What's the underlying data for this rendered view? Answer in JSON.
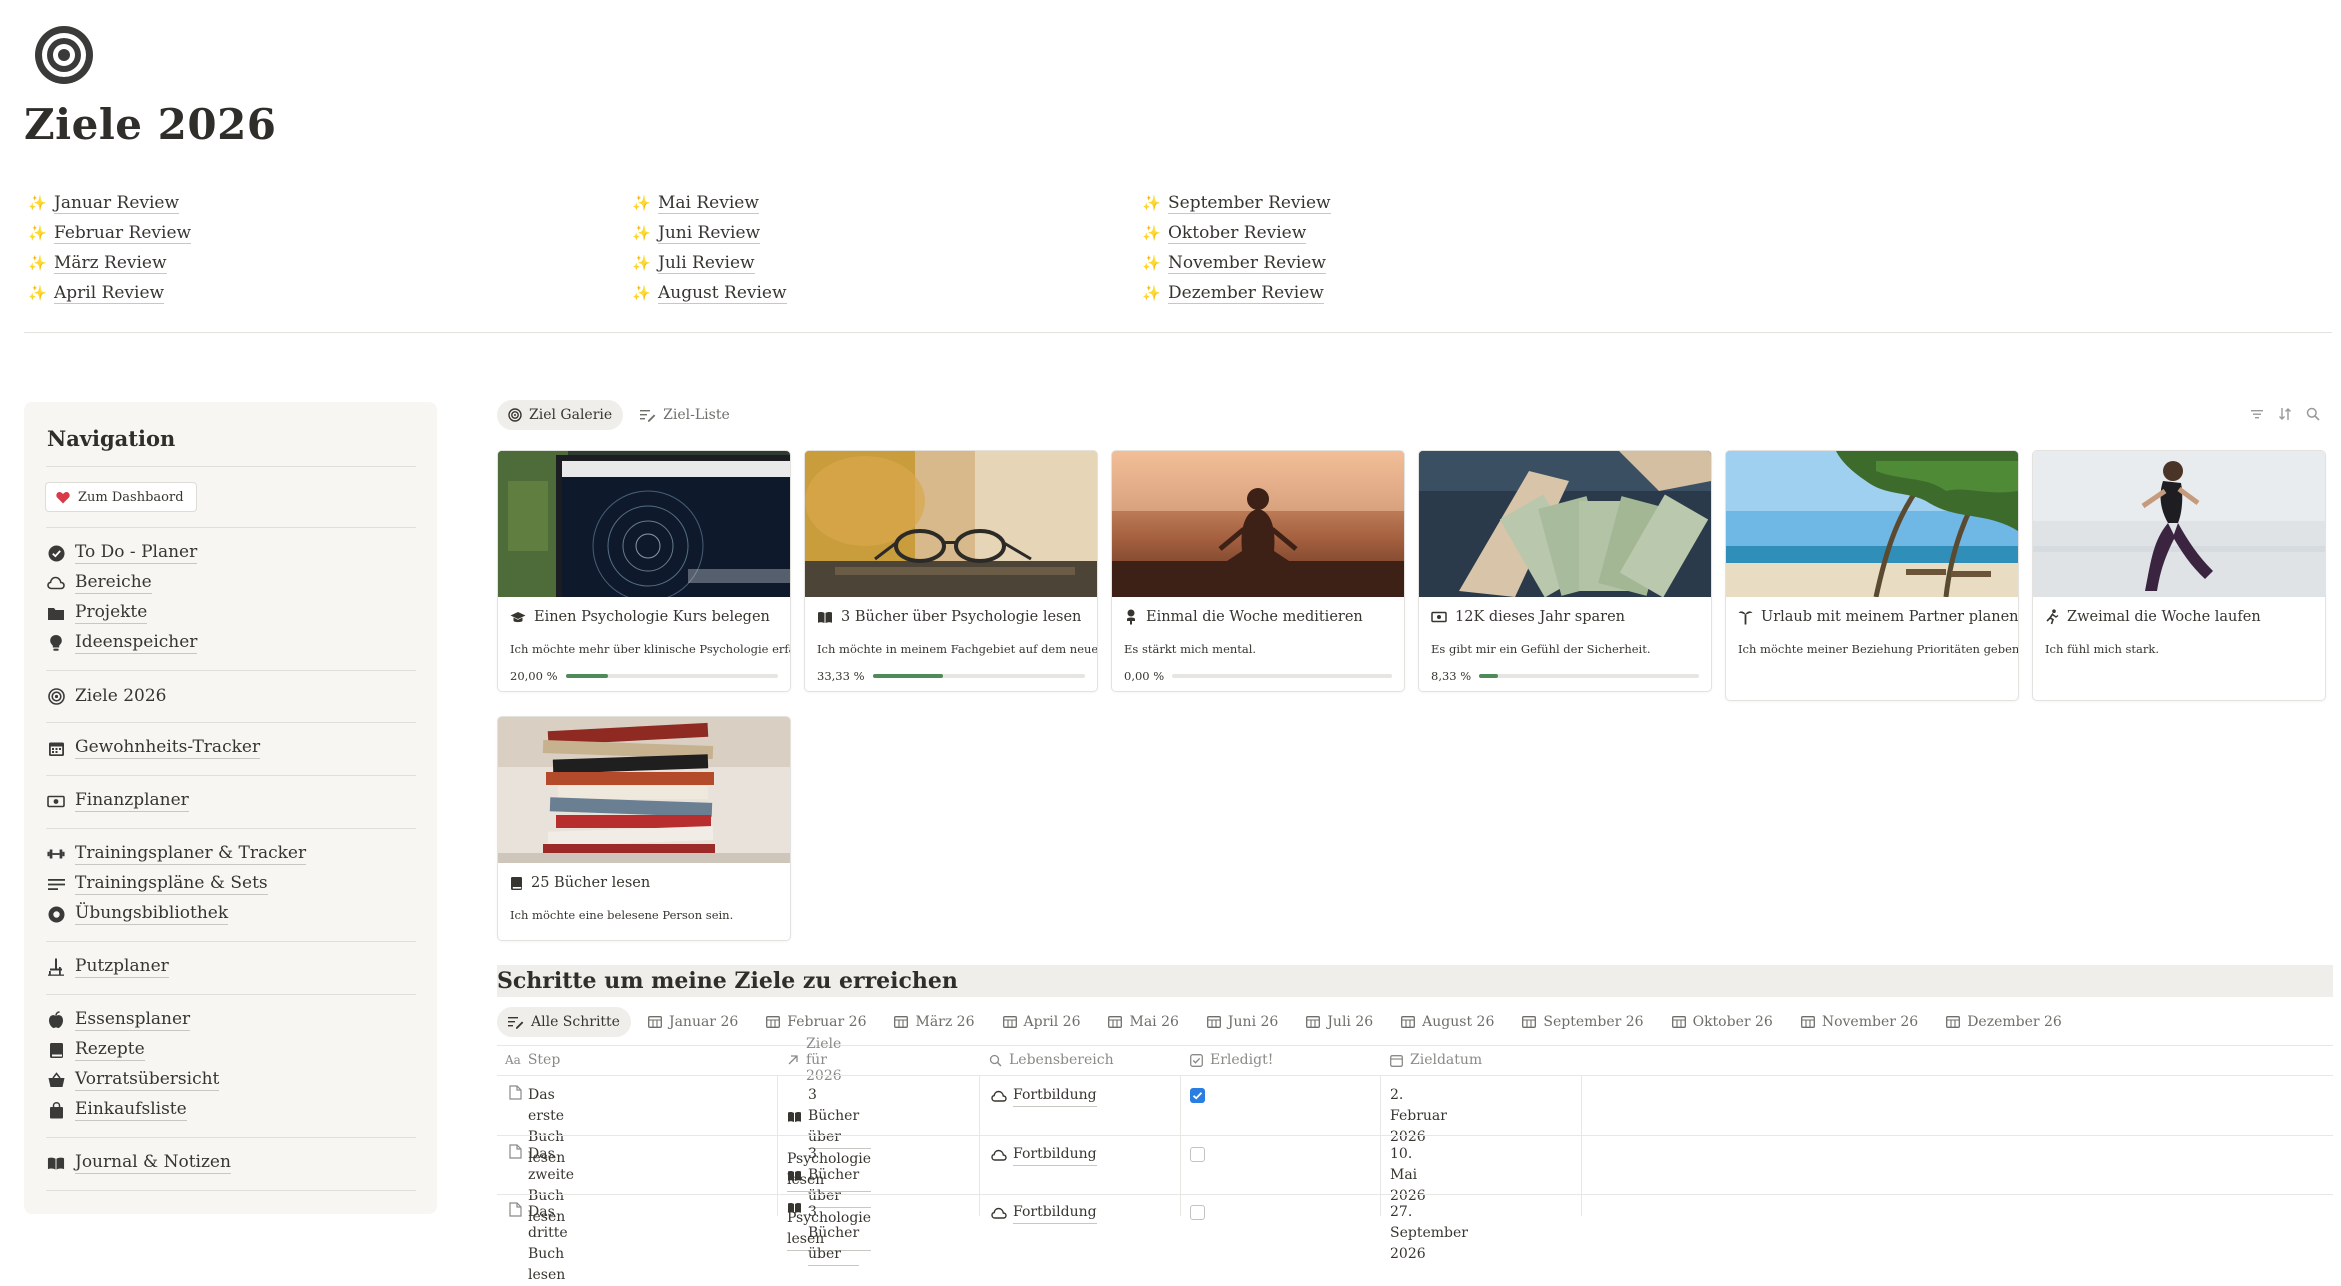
{
  "page": {
    "title": "Ziele 2026",
    "icon": "target-icon"
  },
  "reviews": {
    "col1": [
      "Januar Review",
      "Februar Review",
      "März Review",
      "April Review"
    ],
    "col2": [
      "Mai Review",
      "Juni Review",
      "Juli Review",
      "August Review"
    ],
    "col3": [
      "September Review",
      "Oktober Review",
      "November Review",
      "Dezember Review"
    ],
    "icon": "✨"
  },
  "nav": {
    "title": "Navigation",
    "dashboard_button": "Zum Dashbaord",
    "items": [
      {
        "label": "To Do - Planer",
        "icon": "check-circle-icon"
      },
      {
        "label": "Bereiche",
        "icon": "cloud-icon"
      },
      {
        "label": "Projekte",
        "icon": "folder-icon"
      },
      {
        "label": "Ideenspeicher",
        "icon": "lightbulb-icon"
      },
      {
        "label": "Ziele 2026",
        "icon": "target-icon"
      },
      {
        "label": "Gewohnheits-Tracker",
        "icon": "calendar-icon"
      },
      {
        "label": "Finanzplaner",
        "icon": "money-icon"
      },
      {
        "label": "Trainingsplaner & Tracker",
        "icon": "dumbbell-icon"
      },
      {
        "label": "Trainingspläne & Sets",
        "icon": "list-icon"
      },
      {
        "label": "Übungsbibliothek",
        "icon": "record-icon"
      },
      {
        "label": "Putzplaner",
        "icon": "broom-icon"
      },
      {
        "label": "Essensplaner",
        "icon": "apple-icon"
      },
      {
        "label": "Rezepte",
        "icon": "book-icon"
      },
      {
        "label": "Vorratsübersicht",
        "icon": "basket-icon"
      },
      {
        "label": "Einkaufsliste",
        "icon": "bag-icon"
      },
      {
        "label": "Journal & Notizen",
        "icon": "open-book-icon"
      }
    ]
  },
  "views": {
    "gallery": "Ziel Galerie",
    "list": "Ziel-Liste"
  },
  "goals": [
    {
      "title": "Einen Psychologie Kurs belegen",
      "desc": "Ich möchte mehr über klinische Psychologie erfahren.",
      "progress_text": "20,00 %",
      "progress": 0.2,
      "icon": "graduation-cap-icon"
    },
    {
      "title": "3 Bücher über Psychologie lesen",
      "desc": "Ich möchte in meinem Fachgebiet auf dem neuesten Stand bleiben.",
      "progress_text": "33,33 %",
      "progress": 0.3333,
      "icon": "open-book-icon"
    },
    {
      "title": "Einmal die Woche meditieren",
      "desc": "Es stärkt mich mental.",
      "progress_text": "0,00 %",
      "progress": 0.0,
      "icon": "meditation-icon"
    },
    {
      "title": "12K dieses Jahr sparen",
      "desc": "Es gibt mir ein Gefühl der Sicherheit.",
      "progress_text": "8,33 %",
      "progress": 0.0833,
      "icon": "money-icon"
    },
    {
      "title": "Urlaub mit meinem Partner planen",
      "desc": "Ich möchte meiner Beziehung Prioritäten geben.",
      "icon": "palm-tree-icon"
    },
    {
      "title": "Zweimal die Woche laufen",
      "desc": "Ich fühl mich stark.",
      "icon": "runner-icon"
    },
    {
      "title": "25 Bücher lesen",
      "desc": "Ich möchte eine belesene Person sein.",
      "icon": "book-icon"
    }
  ],
  "steps": {
    "title": "Schritte um meine Ziele zu erreichen",
    "tabs": [
      "Alle Schritte",
      "Januar 26",
      "Februar 26",
      "März 26",
      "April 26",
      "Mai 26",
      "Juni 26",
      "Juli 26",
      "August 26",
      "September 26",
      "Oktober 26",
      "November 26",
      "Dezember 26"
    ],
    "columns": [
      "Step",
      "Ziele für 2026",
      "Lebensbereich",
      "Erledigt!",
      "Zieldatum"
    ],
    "rows": [
      {
        "step": "Das erste Buch lesen",
        "goal_line1": "3 Bücher über",
        "goal_line2": "Psychologie lesen",
        "area": "Fortbildung",
        "done": true,
        "date": "2. Februar 2026"
      },
      {
        "step": "Das zweite Buch lesen",
        "goal_line1": "3 Bücher über",
        "goal_line2": "Psychologie lesen",
        "area": "Fortbildung",
        "done": false,
        "date": "10. Mai 2026"
      },
      {
        "step": "Das dritte Buch lesen",
        "goal_line1": "3 Bücher über",
        "goal_line2": "Psychologie lesen",
        "area": "Fortbildung",
        "done": false,
        "date": "27. September 2026"
      }
    ]
  }
}
